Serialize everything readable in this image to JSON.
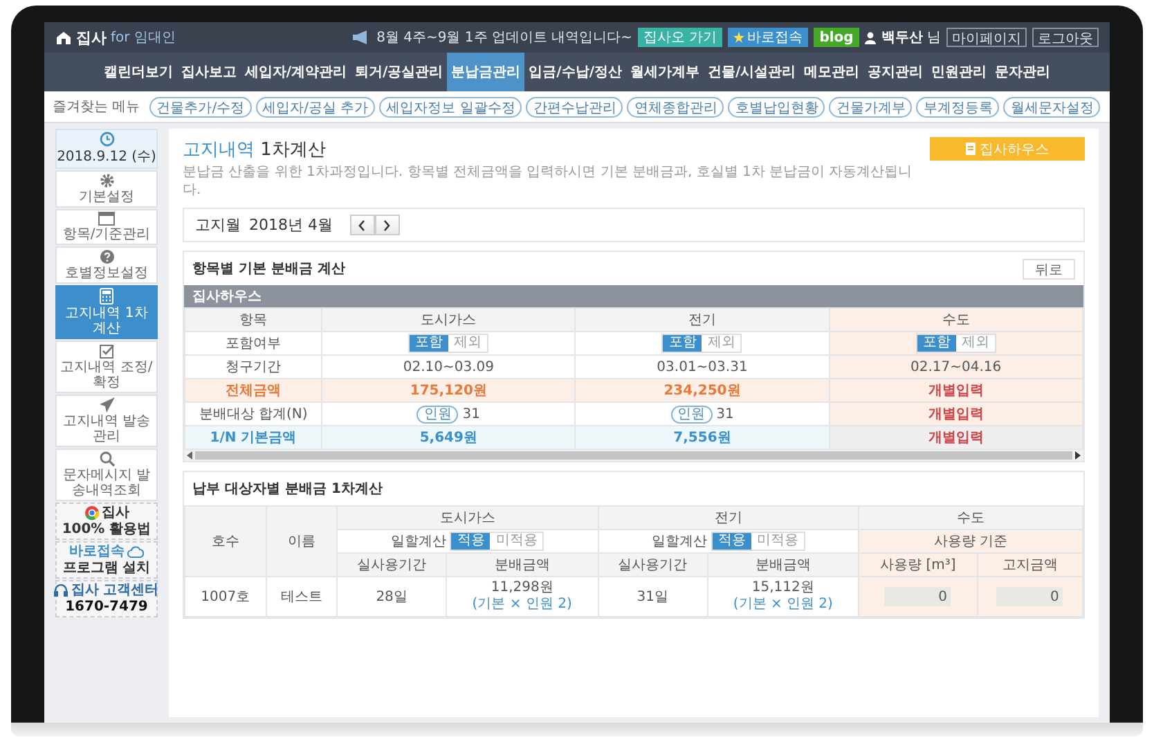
{
  "header": {
    "logo": "집사",
    "logo_sub": "for 임대인",
    "notice": "8월 4주~9월 1주 업데이트 내역입니다~",
    "buttons": [
      {
        "label": "집사오 가기",
        "kind": "teal"
      },
      {
        "label": "바로접속",
        "kind": "star"
      },
      {
        "label": "blog",
        "kind": "blog"
      }
    ],
    "user": "백두산",
    "user_suffix": "님",
    "links": [
      "마이페이지",
      "로그아웃"
    ]
  },
  "nav": [
    {
      "label": "캘린더보기",
      "selected": false
    },
    {
      "label": "집사보고",
      "selected": false
    },
    {
      "label": "세입자/계약관리",
      "selected": false
    },
    {
      "label": "퇴거/공실관리",
      "selected": false
    },
    {
      "label": "분납금관리",
      "selected": true
    },
    {
      "label": "입금/수납/정산",
      "selected": false
    },
    {
      "label": "월세가계부",
      "selected": false
    },
    {
      "label": "건물/시설관리",
      "selected": false
    },
    {
      "label": "메모관리",
      "selected": false
    },
    {
      "label": "공지관리",
      "selected": false
    },
    {
      "label": "민원관리",
      "selected": false
    },
    {
      "label": "문자관리",
      "selected": false
    }
  ],
  "quick_menu": {
    "label": "즐겨찾는 메뉴",
    "items": [
      "건물추가/수정",
      "세입자/공실 추가",
      "세입자정보 일괄수정",
      "간편수납관리",
      "연체종합관리",
      "호별납입현황",
      "건물가계부",
      "부계정등록",
      "월세문자설정"
    ]
  },
  "sidebar": {
    "date": "2018.9.12 (수)",
    "items": [
      {
        "label": "기본설정",
        "selected": false
      },
      {
        "label": "항목/기준관리",
        "selected": false
      },
      {
        "label": "호별정보설정",
        "selected": false
      },
      {
        "label": "고지내역 1차계산",
        "selected": true
      },
      {
        "label": "고지내역 조정/확정",
        "selected": false
      },
      {
        "label": "고지내역 발송관리",
        "selected": false
      },
      {
        "label": "문자메시지 발송내역조회",
        "selected": false
      }
    ],
    "promos": [
      {
        "title": "집사",
        "subtitle": "100% 활용법"
      },
      {
        "title": "바로접속",
        "subtitle": "프로그램 설치"
      },
      {
        "title": "집사 고객센터",
        "subtitle": "1670-7479"
      }
    ]
  },
  "page": {
    "title_highlight": "고지내역",
    "title_rest": "1차계산",
    "description": "분납금 산출을 위한 1차과정입니다. 항목별 전체금액을 입력하시면 기본 분배금과, 호실별 1차 분납금이 자동계산됩니다.",
    "action_button": "집사하우스"
  },
  "month_picker": {
    "label": "고지월",
    "value": "2018년 4월"
  },
  "basic_card": {
    "title": "항목별 기본 분배금 계산",
    "back_button": "뒤로",
    "group": "집사하우스",
    "label_header": "항목",
    "columns": [
      {
        "label": "도시가스",
        "individual": false
      },
      {
        "label": "전기",
        "individual": false
      },
      {
        "label": "수도",
        "individual": true
      }
    ],
    "rows": [
      {
        "kind": "plain",
        "label": "포함여부",
        "cells": [
          {
            "kind": "toggle",
            "options": [
              {
                "label": "포함",
                "selected": true
              },
              {
                "label": "제외",
                "selected": false
              }
            ]
          },
          {
            "kind": "toggle",
            "options": [
              {
                "label": "포함",
                "selected": true
              },
              {
                "label": "제외",
                "selected": false
              }
            ]
          },
          {
            "kind": "toggle",
            "options": [
              {
                "label": "포함",
                "selected": true
              },
              {
                "label": "제외",
                "selected": false
              }
            ]
          }
        ]
      },
      {
        "kind": "plain",
        "label": "청구기간",
        "cells": [
          {
            "kind": "text",
            "value": "02.10~03.09"
          },
          {
            "kind": "text",
            "value": "03.01~03.31"
          },
          {
            "kind": "text",
            "value": "02.17~04.16"
          }
        ]
      },
      {
        "kind": "total",
        "label": "전체금액",
        "cells": [
          {
            "kind": "text",
            "value": "175,120원"
          },
          {
            "kind": "text",
            "value": "234,250원"
          },
          {
            "kind": "manual",
            "value": "개별입력"
          }
        ]
      },
      {
        "kind": "plain",
        "label": "분배대상 합계(N)",
        "cells": [
          {
            "kind": "count",
            "tag": "인원",
            "value": "31"
          },
          {
            "kind": "count",
            "tag": "인원",
            "value": "31"
          },
          {
            "kind": "manual",
            "value": "개별입력"
          }
        ]
      },
      {
        "kind": "base",
        "label": "1/N 기본금액",
        "cells": [
          {
            "kind": "text",
            "value": "5,649원"
          },
          {
            "kind": "text",
            "value": "7,556원"
          },
          {
            "kind": "manual",
            "value": "개별입력"
          }
        ]
      }
    ]
  },
  "tenant_card": {
    "title": "납부 대상자별 분배금 1차계산",
    "fixed_columns": [
      "호수",
      "이름"
    ],
    "groups": [
      {
        "label": "도시가스",
        "kind": "prorate",
        "setting": "일할계산",
        "options": [
          {
            "label": "적용",
            "selected": true
          },
          {
            "label": "미적용",
            "selected": false
          }
        ],
        "columns": [
          "실사용기간",
          "분배금액"
        ]
      },
      {
        "label": "전기",
        "kind": "prorate",
        "setting": "일할계산",
        "options": [
          {
            "label": "적용",
            "selected": true
          },
          {
            "label": "미적용",
            "selected": false
          }
        ],
        "columns": [
          "실사용기간",
          "분배금액"
        ]
      },
      {
        "label": "수도",
        "kind": "usage",
        "setting": "사용량 기준",
        "columns": [
          "사용량 [m³]",
          "고지금액"
        ]
      }
    ],
    "rows": [
      {
        "unit": "1007호",
        "name": "테스트",
        "cells": [
          {
            "kind": "text",
            "value": "28일"
          },
          {
            "kind": "amount",
            "value": "11,298원",
            "note": "(기본 × 인원 2)"
          },
          {
            "kind": "text",
            "value": "31일"
          },
          {
            "kind": "amount",
            "value": "15,112원",
            "note": "(기본 × 인원 2)"
          },
          {
            "kind": "input",
            "value": "0"
          },
          {
            "kind": "input",
            "value": "0"
          }
        ]
      }
    ]
  }
}
